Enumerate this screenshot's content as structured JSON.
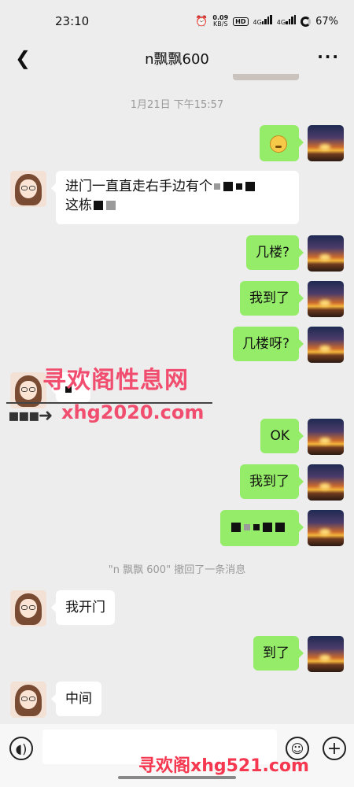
{
  "status_bar": {
    "time": "23:10",
    "net_speed": "0.09",
    "net_unit": "KB/S",
    "hd_label": "HD",
    "net_type_1": "4G",
    "net_type_2": "4G",
    "battery": "67%"
  },
  "header": {
    "title": "n飘飘600",
    "back_icon": "chevron-left-icon",
    "more_icon": "more-dots-icon"
  },
  "chat": {
    "timestamp": "1月21日 下午15:57",
    "messages": [
      {
        "from": "self",
        "type": "emoji",
        "emoji": "thinking-face-icon"
      },
      {
        "from": "other",
        "line1": "进门一直直走右手边有个",
        "line2": "这栋"
      },
      {
        "from": "self",
        "text": "几楼?"
      },
      {
        "from": "self",
        "text": "我到了"
      },
      {
        "from": "self",
        "text": "几楼呀?"
      },
      {
        "from": "other",
        "type": "redacted"
      },
      {
        "from": "self",
        "text": "OK"
      },
      {
        "from": "self",
        "text": "我到了"
      },
      {
        "from": "self",
        "type": "redacted"
      },
      {
        "from": "self",
        "text": "到了"
      }
    ],
    "recall_notice": "\"n 飘飘 600\" 撤回了一条消息",
    "other_messages": {
      "open_door": "我开门",
      "middle": "中间"
    }
  },
  "watermarks": {
    "site_name": "寻欢阁性息网",
    "url": "xhg2020.com",
    "bottom": "寻欢阁xhg521.com"
  },
  "input_bar": {
    "voice_icon": "voice-icon",
    "emoji_icon": "emoji-icon",
    "plus_icon": "plus-icon",
    "input_value": ""
  }
}
